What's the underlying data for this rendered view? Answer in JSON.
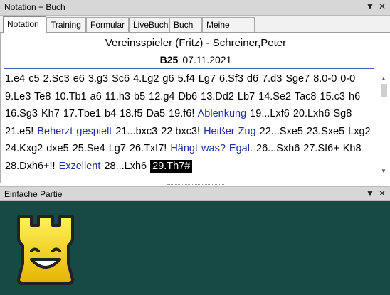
{
  "top_panel": {
    "title": "Notation + Buch",
    "pin": "▼",
    "close": "✕",
    "tabs": [
      "Notation",
      "Training",
      "Formular",
      "LiveBuch",
      "Buch",
      "Meine Züge"
    ]
  },
  "game": {
    "players": "Vereinsspieler (Fritz) - Schreiner,Peter",
    "eco": "B25",
    "date": "07.11.2021"
  },
  "moves": [
    {
      "t": "1.e4  c5  2.Sc3  e6  3.g3  Sc6  4.Lg2  g6  5.f4  Lg7  6.Sf3  d6  7.d3  Sge7  8.0-0  0-0  9.Le3  Te8  10.Tb1  a6  11.h3  b5  12.g4  Db6  13.Dd2  Lb7  14.Se2  Tac8  15.c3  h6  16.Sg3  Kh7  17.Tbe1  b4  18.f5  Da5  19.f6! "
    },
    {
      "c": "Ablenkung"
    },
    {
      "t": "  19...Lxf6  20.Lxh6  Sg8  21.e5! "
    },
    {
      "c": "Beherzt gespielt"
    },
    {
      "t": "  21...bxc3  22.bxc3! "
    },
    {
      "c": "Heißer Zug"
    },
    {
      "t": "  22...Sxe5  23.Sxe5  Lxg2  24.Kxg2  dxe5  25.Se4  Lg7  26.Txf7! "
    },
    {
      "c": "Hängt was? Egal."
    },
    {
      "t": "  26...Sxh6  27.Sf6+  Kh8  28.Dxh6+!! "
    },
    {
      "c": "Exzellent"
    },
    {
      "t": "  28...Lxh6  "
    },
    {
      "cur": "29.Th7#"
    }
  ],
  "bottom_panel": {
    "title": "Einfache Partie",
    "pin": "▼",
    "close": "✕",
    "logo_icon": "smiling-rook-icon",
    "board_color": "#174945"
  }
}
